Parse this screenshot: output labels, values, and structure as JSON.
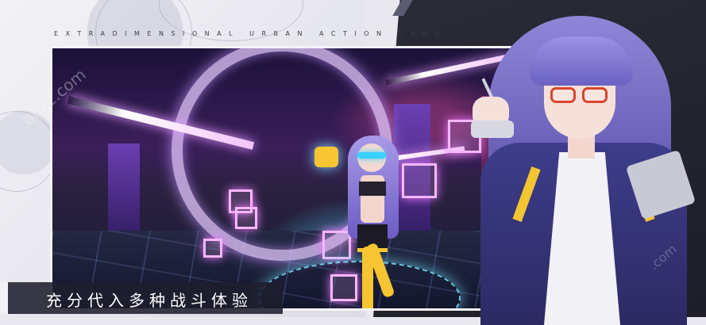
{
  "banner": {
    "tagline": "EXTRADIMENSIONAL URBAN ACTION GAME",
    "caption": "充分代入多种战斗体验"
  },
  "watermarks": {
    "left": "anxz.com",
    "right": ".com"
  },
  "colors": {
    "caption_bg": "#1e1e2e",
    "accent_white": "#f1f1f5",
    "neon_pink": "#f6b7ff",
    "neon_cyan": "#3ad0ff",
    "jacket_navy": "#3e3d8b",
    "stripe_yellow": "#f2c531"
  },
  "icons": [
    "glasses-icon",
    "pen-icon"
  ]
}
